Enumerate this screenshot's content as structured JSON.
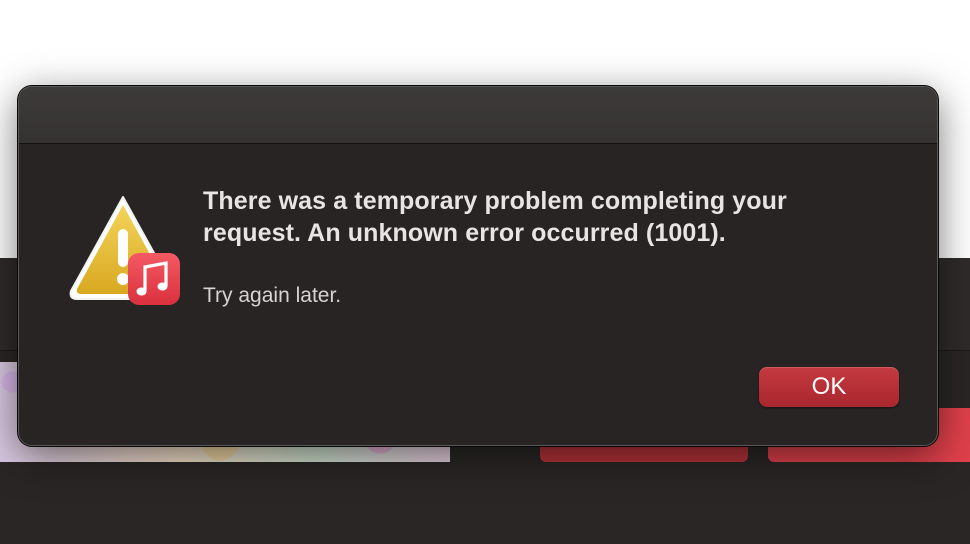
{
  "dialog": {
    "title": "There was a temporary problem completing your request. An unknown error occurred (1001).",
    "informative_text": "Try again later.",
    "ok_label": "OK",
    "icon": "warning-icon",
    "app_badge_icon": "music-icon"
  },
  "colors": {
    "dialog_background": "#282424",
    "ok_button": "#b8303a",
    "warning_yellow": "#e8c13a",
    "music_badge": "#e8404c"
  }
}
